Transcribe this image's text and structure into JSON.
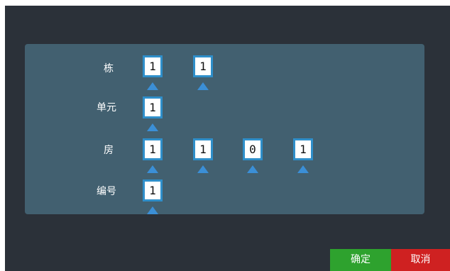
{
  "rows": [
    {
      "label": "栋",
      "digits": [
        "1",
        "1"
      ]
    },
    {
      "label": "单元",
      "digits": [
        "1"
      ]
    },
    {
      "label": "房",
      "digits": [
        "1",
        "1",
        "0",
        "1"
      ]
    },
    {
      "label": "编号",
      "digits": [
        "1"
      ]
    }
  ],
  "buttons": {
    "confirm_label": "确定",
    "cancel_label": "取消"
  },
  "icons": {
    "increment": "triangle-up-icon"
  },
  "colors": {
    "background": "#2b3139",
    "panel": "#426070",
    "input_border": "#2f8fca",
    "arrow": "#3b8fd6",
    "confirm": "#2ea22e",
    "cancel": "#cf2121"
  }
}
